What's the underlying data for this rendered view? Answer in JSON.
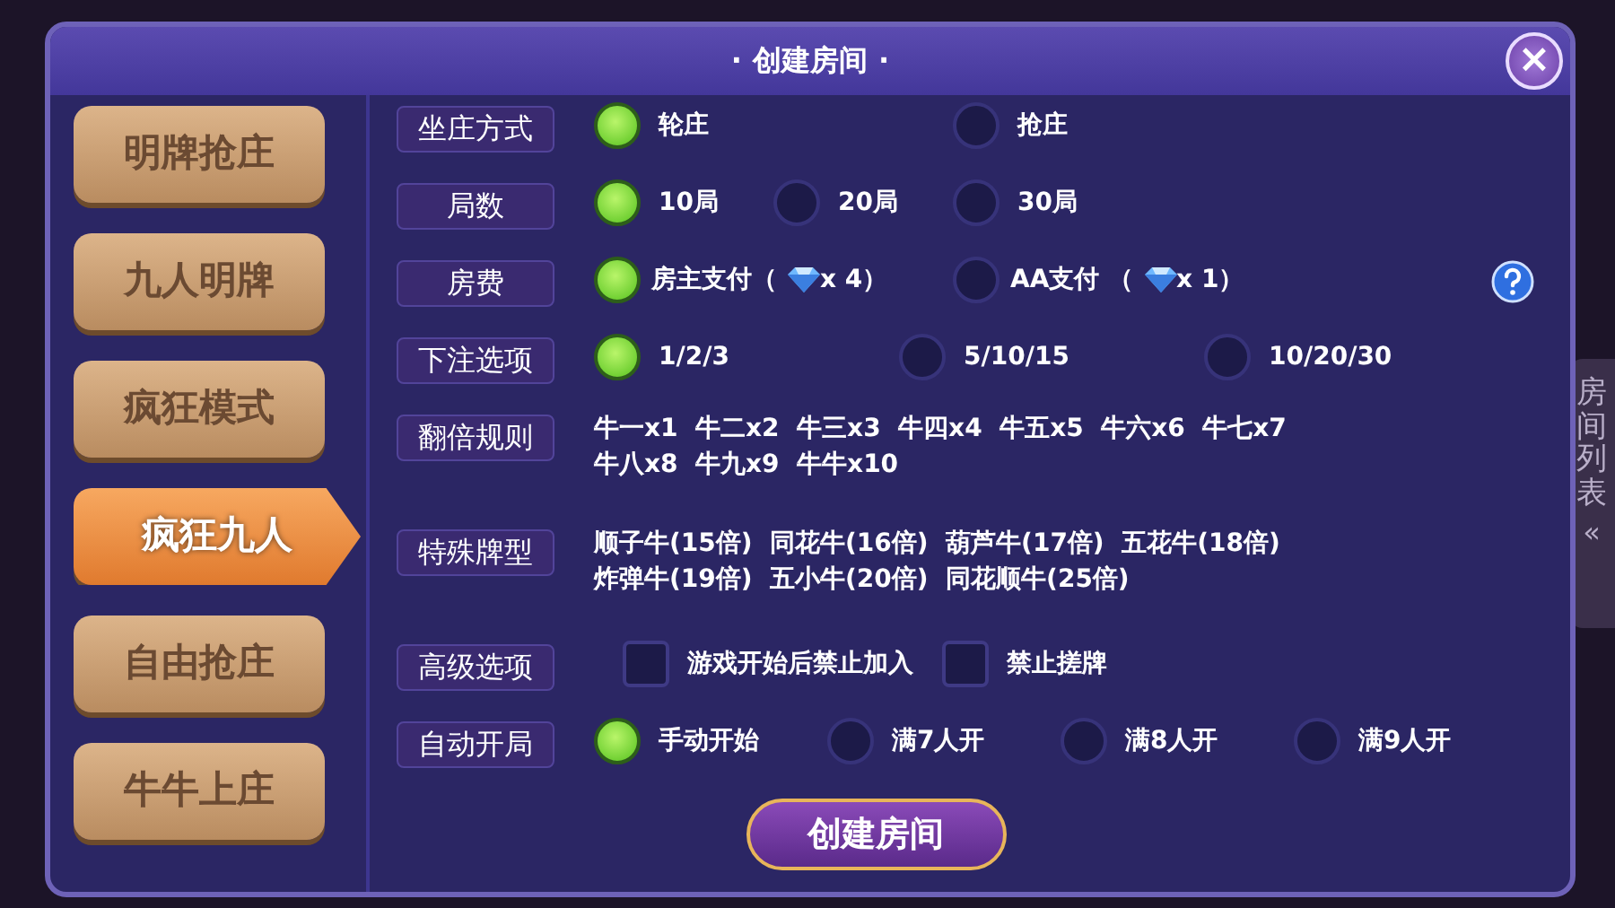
{
  "dialog": {
    "title": "创建房间",
    "title_dots": [
      "·",
      "·"
    ],
    "close": "×"
  },
  "modes": [
    {
      "label": "明牌抢庄",
      "selected": false
    },
    {
      "label": "九人明牌",
      "selected": false
    },
    {
      "label": "疯狂模式",
      "selected": false
    },
    {
      "label": "疯狂九人",
      "selected": true
    },
    {
      "label": "自由抢庄",
      "selected": false
    },
    {
      "label": "牛牛上庄",
      "selected": false
    }
  ],
  "settings": [
    {
      "kind": "radio",
      "label": "坐庄方式",
      "options": [
        {
          "label": "轮庄",
          "selected": true
        },
        {
          "label": "抢庄",
          "selected": false
        }
      ]
    },
    {
      "kind": "radio",
      "label": "局数",
      "options": [
        {
          "label": "10局",
          "selected": true
        },
        {
          "label": "20局",
          "selected": false
        },
        {
          "label": "30局",
          "selected": false
        }
      ]
    },
    {
      "kind": "radio",
      "label": "房费",
      "has_help": true,
      "options": [
        {
          "label": "房主支付（",
          "after": "x 4）",
          "selected": true
        },
        {
          "label": "AA支付 （",
          "after": "x 1）",
          "selected": false
        }
      ]
    },
    {
      "kind": "radio",
      "label": "下注选项",
      "options": [
        {
          "label": "1/2/3",
          "selected": true
        },
        {
          "label": "5/10/15",
          "selected": false
        },
        {
          "label": "10/20/30",
          "selected": false
        }
      ]
    },
    {
      "kind": "text",
      "label": "翻倍规则",
      "lines": [
        "牛一x1  牛二x2  牛三x3  牛四x4  牛五x5  牛六x6  牛七x7",
        "牛八x8  牛九x9  牛牛x10"
      ]
    },
    {
      "kind": "text",
      "label": "特殊牌型",
      "lines": [
        "顺子牛(15倍)  同花牛(16倍)  葫芦牛(17倍)  五花牛(18倍)",
        "炸弹牛(19倍)  五小牛(20倍)  同花顺牛(25倍)"
      ]
    },
    {
      "kind": "checkbox",
      "label": "高级选项",
      "options": [
        {
          "label": "游戏开始后禁止加入",
          "checked": false
        },
        {
          "label": "禁止搓牌",
          "checked": false
        }
      ]
    },
    {
      "kind": "radio",
      "label": "自动开局",
      "options": [
        {
          "label": "手动开始",
          "selected": true
        },
        {
          "label": "满7人开",
          "selected": false
        },
        {
          "label": "满8人开",
          "selected": false
        },
        {
          "label": "满9人开",
          "selected": false
        }
      ]
    }
  ],
  "create_button": "创建房间",
  "side_tab": {
    "text": "房间列表",
    "arrows": "«"
  }
}
